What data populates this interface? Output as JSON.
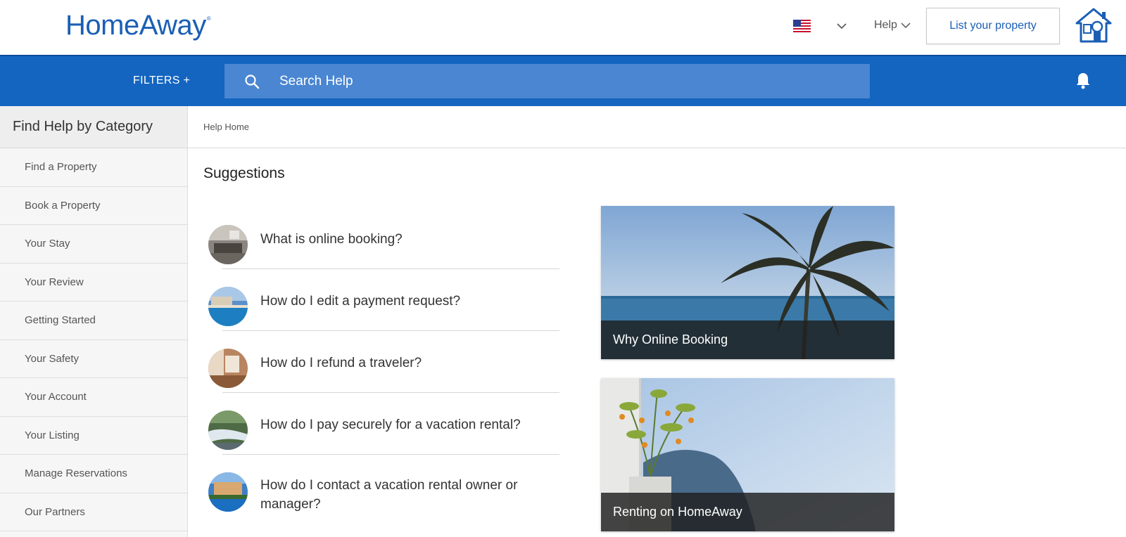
{
  "header": {
    "logo_text": "HomeAway",
    "logo_mark": "®",
    "help_label": "Help",
    "list_property_label": "List your property",
    "brand_color": "#1a5fb4"
  },
  "searchbar": {
    "filters_label": "FILTERS +",
    "search_placeholder": "Search Help",
    "bar_color": "#1465c0"
  },
  "sidebar": {
    "title": "Find Help by Category",
    "items": [
      {
        "label": "Find a Property"
      },
      {
        "label": "Book a Property"
      },
      {
        "label": "Your Stay"
      },
      {
        "label": "Your Review"
      },
      {
        "label": "Getting Started"
      },
      {
        "label": "Your Safety"
      },
      {
        "label": "Your Account"
      },
      {
        "label": "Your Listing"
      },
      {
        "label": "Manage Reservations"
      },
      {
        "label": "Our Partners"
      }
    ]
  },
  "main": {
    "breadcrumb": "Help Home",
    "section_title": "Suggestions",
    "suggestions": [
      {
        "question": "What is online booking?",
        "icon": "living-room-photo"
      },
      {
        "question": "How do I edit a payment request?",
        "icon": "pool-photo"
      },
      {
        "question": "How do I refund a traveler?",
        "icon": "interior-photo"
      },
      {
        "question": "How do I pay securely for a vacation rental?",
        "icon": "river-photo"
      },
      {
        "question": "How do I contact a vacation rental owner or manager?",
        "icon": "villa-photo"
      }
    ],
    "cards": [
      {
        "caption": "Why Online Booking",
        "image": "palm-tree-ocean"
      },
      {
        "caption": "Renting on HomeAway",
        "image": "coastal-plant"
      }
    ]
  }
}
